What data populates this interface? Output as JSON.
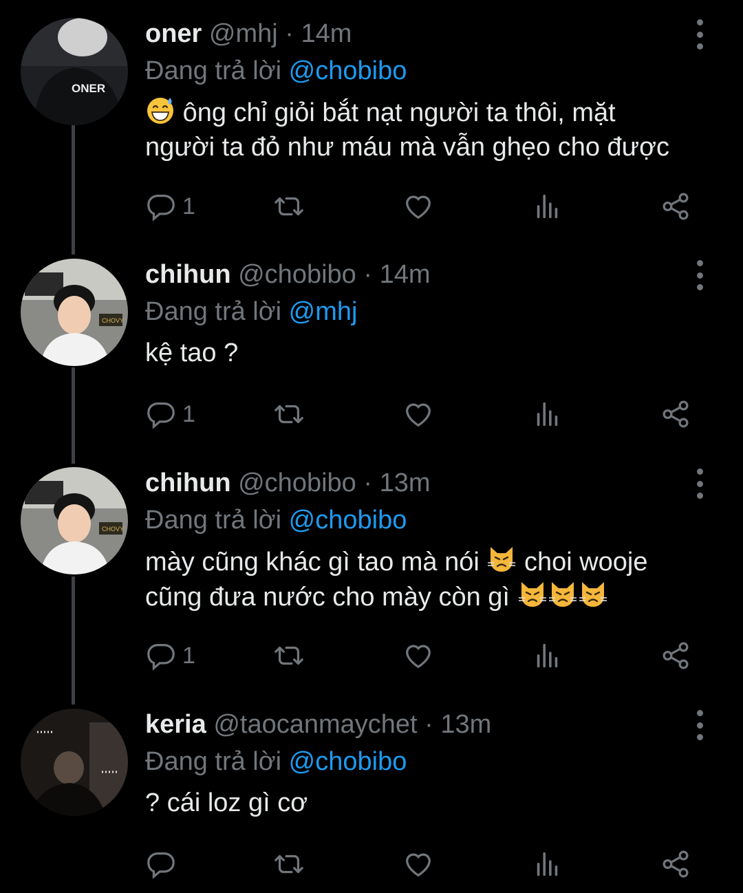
{
  "tweets": [
    {
      "name": "oner",
      "handle": "@mhj",
      "time": "14m",
      "reply_prefix": "Đang trả lời",
      "reply_handle": "@chobibo",
      "text_lines": [
        "ông chỉ giỏi bắt nạt người ta thôi, mặt",
        "người ta đỏ như máu mà vẫn ghẹo cho được"
      ],
      "lead_emoji": "grinning-sweat-emoji",
      "reply_count": "1",
      "avatar_text": "ONER"
    },
    {
      "name": "chihun",
      "handle": "@chobibo",
      "time": "14m",
      "reply_prefix": "Đang trả lời",
      "reply_handle": "@mhj",
      "text_lines": [
        "kệ tao ?"
      ],
      "reply_count": "1",
      "avatar_text": "CHOVY"
    },
    {
      "name": "chihun",
      "handle": "@chobibo",
      "time": "13m",
      "reply_prefix": "Đang trả lời",
      "reply_handle": "@chobibo",
      "text_lines": [
        "mày cũng khác gì tao mà nói",
        "choi wooje",
        "cũng đưa nước cho mày còn gì"
      ],
      "emoji": "pouting-cat-emoji",
      "reply_count": "1",
      "avatar_text": "CHOVY"
    },
    {
      "name": "keria",
      "handle": "@taocanmaychet",
      "time": "13m",
      "reply_prefix": "Đang trả lời",
      "reply_handle": "@chobibo",
      "text_lines": [
        "? cái loz gì cơ"
      ],
      "reply_count": ""
    }
  ],
  "dot": "·",
  "colors": {
    "background": "#000000",
    "text": "#e7e9ea",
    "muted": "#71767b",
    "link": "#1d9bf0"
  }
}
